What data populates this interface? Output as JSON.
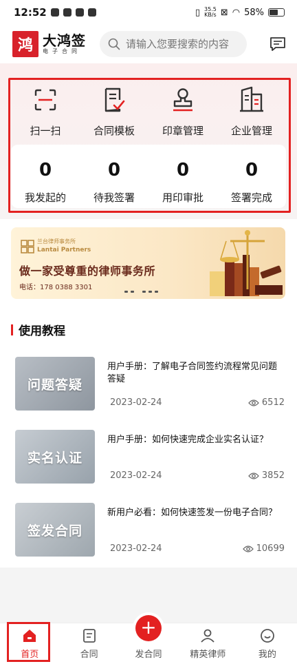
{
  "status_bar": {
    "time": "12:52",
    "speed_value": "35.5",
    "speed_unit": "KB/s",
    "battery": "58%"
  },
  "header": {
    "logo_char": "鸿",
    "brand_name": "大鸿签",
    "brand_sub": "电子合同",
    "search_placeholder": "请输入您要搜索的内容"
  },
  "quick_actions": [
    {
      "label": "扫一扫",
      "icon": "scan-icon"
    },
    {
      "label": "合同模板",
      "icon": "contract-template-icon"
    },
    {
      "label": "印章管理",
      "icon": "stamp-icon"
    },
    {
      "label": "企业管理",
      "icon": "enterprise-icon"
    }
  ],
  "stats": [
    {
      "value": "0",
      "label": "我发起的"
    },
    {
      "value": "0",
      "label": "待我签署"
    },
    {
      "value": "0",
      "label": "用印审批"
    },
    {
      "value": "0",
      "label": "签署完成"
    }
  ],
  "banner": {
    "firm_cn": "兰台律师事务所",
    "firm_en": "Lantai Partners",
    "title": "做一家受尊重的律师事务所",
    "phone": "电话：178 0388 3301"
  },
  "tutorials": {
    "title": "使用教程",
    "articles": [
      {
        "thumb_text": "问题答疑",
        "title": "用户手册：了解电子合同签约流程常见问题答疑",
        "date": "2023-02-24",
        "views": "6512",
        "thumb_color": "#9aa3ad"
      },
      {
        "thumb_text": "实名认证",
        "title": "用户手册：如何快速完成企业实名认证？",
        "date": "2023-02-24",
        "views": "3852",
        "thumb_color": "#a9b4bc"
      },
      {
        "thumb_text": "签发合同",
        "title": "新用户必看：如何快速签发一份电子合同？",
        "date": "2023-02-24",
        "views": "10699",
        "thumb_color": "#aeb6bd"
      }
    ]
  },
  "tabbar": [
    {
      "label": "首页",
      "icon": "home-icon",
      "active": true
    },
    {
      "label": "合同",
      "icon": "contract-icon",
      "active": false
    },
    {
      "label": "发合同",
      "icon": "plus-icon",
      "active": false
    },
    {
      "label": "精英律师",
      "icon": "lawyer-icon",
      "active": false
    },
    {
      "label": "我的",
      "icon": "profile-icon",
      "active": false
    }
  ],
  "colors": {
    "accent": "#e32121",
    "brand": "#d8222b"
  }
}
